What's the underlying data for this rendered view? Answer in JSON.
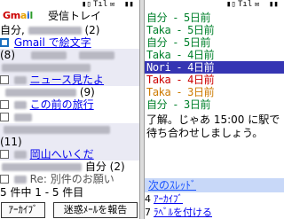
{
  "status_bar": {
    "left_icons": [
      "signal-antenna",
      "mail",
      "battery"
    ],
    "right_icons": [
      "signal-antenna",
      "mail",
      "battery"
    ]
  },
  "inbox": {
    "logo": "Gmail",
    "title": "受信トレイ",
    "rows": [
      {
        "sender": "自分,",
        "count": "(2)"
      },
      {
        "subject": "Gmail で絵文字"
      },
      {
        "count": "(8)"
      },
      {
        "subject": "ニュース見たよ"
      },
      {
        "count": "(9)"
      },
      {
        "subject": "この前の旅行"
      },
      {
        "count": "(11)"
      },
      {
        "subject": "岡山へいくだ"
      },
      {
        "sender": "自分",
        "count": "(2)"
      },
      {
        "subject": "Re: 別件のお願い"
      }
    ],
    "paging": "5 件中 1 - 5 件目",
    "archive_button": "ｱｰｶｲﾌﾞ",
    "spam_button": "迷惑ﾒｰﾙを報告"
  },
  "thread": {
    "rows": [
      {
        "sender": "自分",
        "sep": "-",
        "time": "5日前",
        "style": "green"
      },
      {
        "sender": "Taka",
        "sep": "-",
        "time": "5日前",
        "style": "green"
      },
      {
        "sender": "自分",
        "sep": "-",
        "time": "5日前",
        "style": "green"
      },
      {
        "sender": "Taka",
        "sep": "-",
        "time": "4日前",
        "style": "green"
      },
      {
        "sender": "Nori",
        "sep": "-",
        "time": "4日前",
        "style": "inverted"
      },
      {
        "sender": "Taka",
        "sep": "-",
        "time": "4日前",
        "style": "red"
      },
      {
        "sender": "Taka",
        "sep": "-",
        "time": "3日前",
        "style": "orange"
      },
      {
        "sender": "自分",
        "sep": "-",
        "time": "3日前",
        "style": "green"
      }
    ],
    "message": "了解。じゃあ 15:00 に駅で待ち合わせしましょう。",
    "next_thread": "次のｽﾚｯﾄﾞ",
    "menu": [
      {
        "key": "4",
        "label": "ｱｰｶｲﾌﾞ"
      },
      {
        "key": "7",
        "label": "ﾗﾍﾞﾙを付ける"
      }
    ]
  },
  "colors": {
    "link": "#0000ee",
    "thread_green": "#00802b",
    "highlight": "#3535b3",
    "next_bar": "#c8d8f8"
  }
}
